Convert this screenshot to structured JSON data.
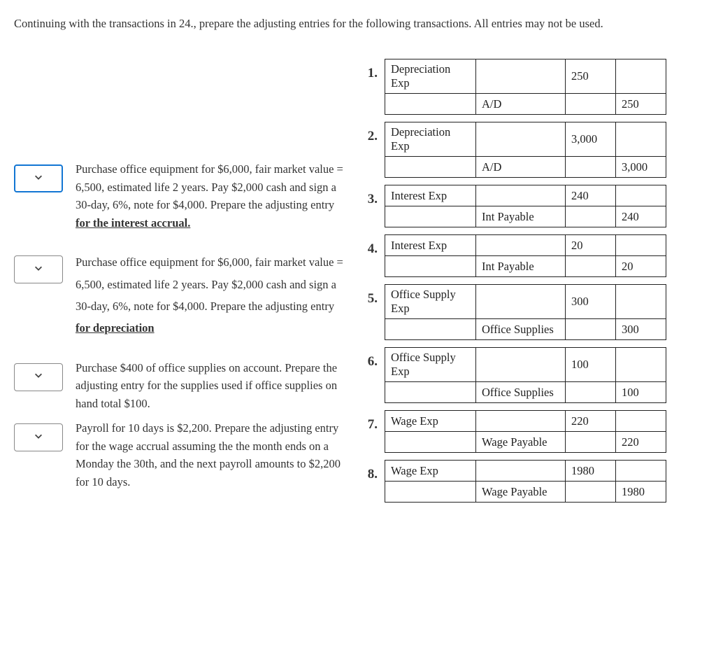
{
  "instructions": "Continuing with the transactions in 24., prepare the adjusting entries for the following transactions. All entries may not be used.",
  "questions": [
    {
      "selected": true,
      "text_parts": [
        "Purchase office equipment for $6,000, fair market value = 6,500, estimated life 2 years.  Pay $2,000 cash and sign a 30-day, 6%, note for $4,000. Prepare the adjusting entry ",
        "for the interest accrual."
      ]
    },
    {
      "selected": false,
      "text_parts": [
        "Purchase office equipment for $6,000, fair market value = 6,500, estimated life 2 years.  Pay $2,000 cash and sign a 30-day, 6%, note for $4,000. Prepare the adjusting entry ",
        "for depreciation"
      ]
    },
    {
      "selected": false,
      "text_parts": [
        "Purchase $400 of office supplies on account. Prepare the adjusting entry for the supplies used if office supplies on hand total $100.",
        ""
      ]
    },
    {
      "selected": false,
      "text_parts": [
        "Payroll for 10 days is $2,200. Prepare the adjusting entry for the wage accrual assuming the the month ends on a Monday the 30th, and the next payroll amounts to $2,200 for 10 days.",
        ""
      ]
    }
  ],
  "entries": [
    {
      "num": "1.",
      "debit_acct": "Depreciation Exp",
      "credit_acct": "A/D",
      "debit": "250",
      "credit": "250"
    },
    {
      "num": "2.",
      "debit_acct": "Depreciation Exp",
      "credit_acct": "A/D",
      "debit": "3,000",
      "credit": "3,000"
    },
    {
      "num": "3.",
      "debit_acct": "Interest Exp",
      "credit_acct": "Int Payable",
      "debit": "240",
      "credit": "240"
    },
    {
      "num": "4.",
      "debit_acct": "Interest Exp",
      "credit_acct": "Int Payable",
      "debit": "20",
      "credit": "20"
    },
    {
      "num": "5.",
      "debit_acct": "Office Supply Exp",
      "credit_acct": "Office Supplies",
      "debit": "300",
      "credit": "300"
    },
    {
      "num": "6.",
      "debit_acct": "Office Supply Exp",
      "credit_acct": "Office Supplies",
      "debit": "100",
      "credit": "100"
    },
    {
      "num": "7.",
      "debit_acct": "Wage Exp",
      "credit_acct": "Wage Payable",
      "debit": "220",
      "credit": "220"
    },
    {
      "num": "8.",
      "debit_acct": "Wage Exp",
      "credit_acct": "Wage Payable",
      "debit": "1980",
      "credit": "1980"
    }
  ]
}
